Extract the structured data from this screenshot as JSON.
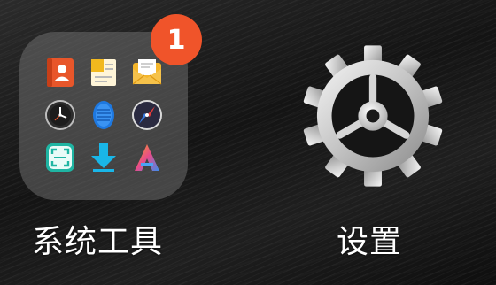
{
  "folder": {
    "name": "系统工具",
    "badge_count": "1",
    "apps": [
      {
        "icon": "contacts-icon",
        "color": "#e8562a"
      },
      {
        "icon": "notes-icon",
        "color": "#f1b81e"
      },
      {
        "icon": "email-icon",
        "color": "#f4b62c"
      },
      {
        "icon": "clock-icon",
        "color": "#2c2c2c"
      },
      {
        "icon": "voice-recorder-icon",
        "color": "#1e78e0"
      },
      {
        "icon": "compass-icon",
        "color": "#2a2a40"
      },
      {
        "icon": "scanner-icon",
        "color": "#1fb5a3"
      },
      {
        "icon": "download-icon",
        "color": "#19b6e8"
      },
      {
        "icon": "app-store-icon",
        "color": "#e94b8a"
      }
    ]
  },
  "settings": {
    "name": "设置",
    "icon": "gear-icon"
  }
}
